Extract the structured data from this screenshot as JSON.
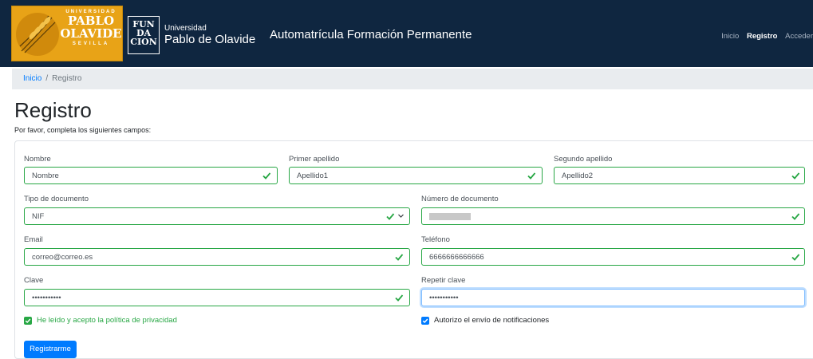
{
  "header": {
    "upo_logo": {
      "top": "UNIVERSIDAD",
      "line1": "PABLO",
      "line2": "OLAVIDE",
      "bottom": "SEVILLA"
    },
    "fundacion_logo": {
      "line1": "FUN",
      "line2": "DA",
      "line3": "CION"
    },
    "fundacion_univ_line1": "Universidad",
    "fundacion_univ_line2": "Pablo de Olavide",
    "app_title": "Automatrícula Formación Permanente",
    "nav": {
      "inicio": "Inicio",
      "registro": "Registro",
      "acceder": "Acceder"
    }
  },
  "breadcrumb": {
    "home": "Inicio",
    "separator": "/",
    "current": "Registro"
  },
  "page": {
    "title": "Registro",
    "subtitle": "Por favor, completa los siguientes campos:"
  },
  "form": {
    "nombre": {
      "label": "Nombre",
      "value": "Nombre"
    },
    "apellido1": {
      "label": "Primer apellido",
      "value": "Apellido1"
    },
    "apellido2": {
      "label": "Segundo apellido",
      "value": "Apellido2"
    },
    "tipo_documento": {
      "label": "Tipo de documento",
      "value": "NIF"
    },
    "numero_documento": {
      "label": "Número de documento",
      "value": ""
    },
    "email": {
      "label": "Email",
      "value": "correo@correo.es"
    },
    "telefono": {
      "label": "Teléfono",
      "value": "6666666666666"
    },
    "clave": {
      "label": "Clave",
      "value": "•••••••••••"
    },
    "repetir_clave": {
      "label": "Repetir clave",
      "value": "•••••••••••"
    },
    "privacidad": "He leído y acepto la política de privacidad",
    "notificaciones": "Autorizo el envío de notificaciones",
    "submit": "Registrarme"
  },
  "colors": {
    "navbar": "#0f2640",
    "valid": "#28a745",
    "primary": "#007bff"
  }
}
